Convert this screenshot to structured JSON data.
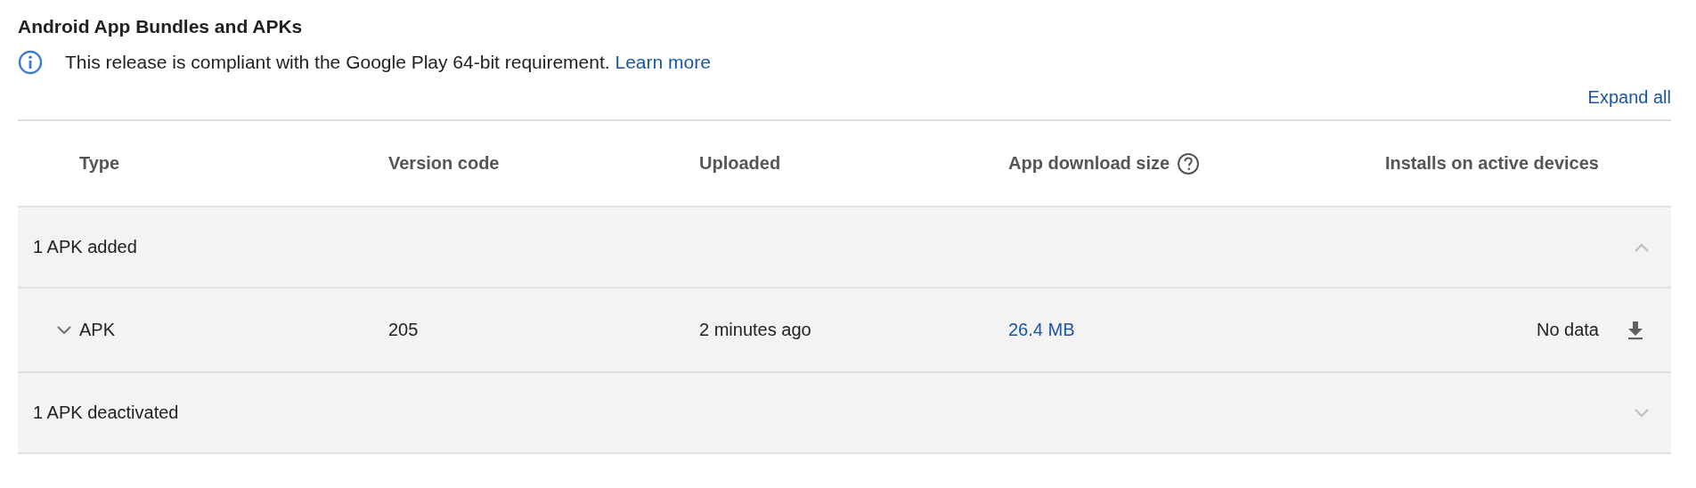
{
  "section": {
    "title": "Android App Bundles and APKs"
  },
  "notice": {
    "text": "This release is compliant with the Google Play 64-bit requirement.",
    "link": "Learn more"
  },
  "expand_all": "Expand all",
  "table": {
    "columns": [
      {
        "label": "Type",
        "help": false
      },
      {
        "label": "Version code",
        "help": false
      },
      {
        "label": "Uploaded",
        "help": false
      },
      {
        "label": "App download size",
        "help": true
      },
      {
        "label": "Installs on active devices",
        "help": false
      }
    ],
    "groups": [
      {
        "label": "1 APK added",
        "expanded": true,
        "rows": [
          {
            "type": "APK",
            "expanded": false,
            "version_code": "205",
            "uploaded": "2 minutes ago",
            "download_size": "26.4 MB",
            "installs": "No data"
          }
        ]
      },
      {
        "label": "1 APK deactivated",
        "expanded": false
      }
    ]
  }
}
